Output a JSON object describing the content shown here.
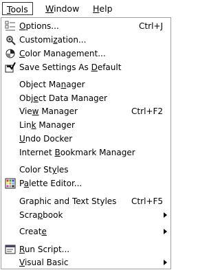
{
  "menubar": {
    "items": [
      {
        "label": "Tools",
        "mnemonic": "T",
        "rest": "ools"
      },
      {
        "label": "Window",
        "mnemonic": "W",
        "rest": "indow"
      },
      {
        "label": "Help",
        "mnemonic": "H",
        "rest": "elp"
      }
    ]
  },
  "menu": {
    "items": [
      {
        "pre": "",
        "mn": "O",
        "post": "ptions...",
        "shortcut": "Ctrl+J",
        "icon": "options-icon"
      },
      {
        "pre": "Customi",
        "mn": "z",
        "post": "ation...",
        "shortcut": "",
        "icon": "customization-icon"
      },
      {
        "pre": "",
        "mn": "C",
        "post": "olor Management...",
        "shortcut": "",
        "icon": "color-management-icon"
      },
      {
        "pre": "Save Settings As ",
        "mn": "D",
        "post": "efault",
        "shortcut": "",
        "icon": "save-settings-icon"
      },
      {
        "pre": "Object Ma",
        "mn": "n",
        "post": "ager",
        "shortcut": ""
      },
      {
        "pre": "Obj",
        "mn": "e",
        "post": "ct Data Manager",
        "shortcut": ""
      },
      {
        "pre": "Vie",
        "mn": "w",
        "post": " Manager",
        "shortcut": "Ctrl+F2"
      },
      {
        "pre": "Lin",
        "mn": "k",
        "post": " Manager",
        "shortcut": ""
      },
      {
        "pre": "",
        "mn": "U",
        "post": "ndo Docker",
        "shortcut": ""
      },
      {
        "pre": "Internet ",
        "mn": "B",
        "post": "ookmark Manager",
        "shortcut": ""
      },
      {
        "pre": "Color St",
        "mn": "y",
        "post": "les",
        "shortcut": ""
      },
      {
        "pre": "P",
        "mn": "a",
        "post": "lette Editor...",
        "shortcut": "",
        "icon": "palette-editor-icon"
      },
      {
        "pre": "Graphic and Text Styles",
        "mn": "",
        "post": "",
        "shortcut": "Ctrl+F5"
      },
      {
        "pre": "Scra",
        "mn": "p",
        "post": "book",
        "shortcut": "",
        "submenu": true
      },
      {
        "pre": "Creat",
        "mn": "e",
        "post": "",
        "shortcut": "",
        "submenu": true
      },
      {
        "pre": "",
        "mn": "R",
        "post": "un Script...",
        "shortcut": "",
        "icon": "run-script-icon"
      },
      {
        "pre": "",
        "mn": "V",
        "post": "isual Basic",
        "shortcut": "",
        "submenu": true
      }
    ]
  }
}
